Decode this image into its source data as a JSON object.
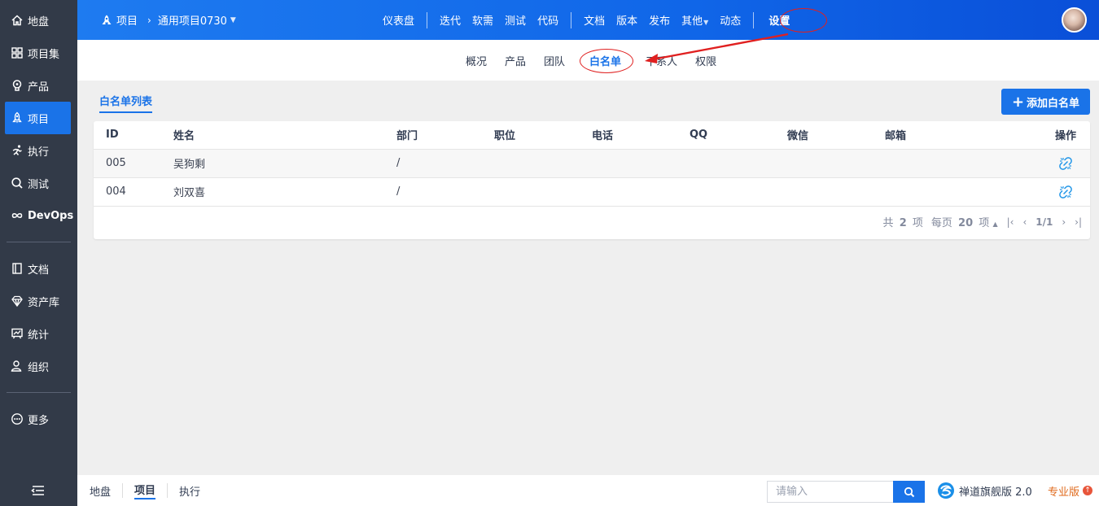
{
  "sidebar": {
    "items": [
      {
        "label": "地盘",
        "icon": "home-icon"
      },
      {
        "label": "项目集",
        "icon": "grid-icon"
      },
      {
        "label": "产品",
        "icon": "bulb-icon"
      },
      {
        "label": "项目",
        "icon": "rocket-icon",
        "active": true
      },
      {
        "label": "执行",
        "icon": "run-icon"
      },
      {
        "label": "测试",
        "icon": "magnifier-icon"
      },
      {
        "label": "DevOps",
        "icon": "infinity-icon"
      },
      {
        "label": "文档",
        "icon": "book-icon"
      },
      {
        "label": "资产库",
        "icon": "diamond-icon"
      },
      {
        "label": "统计",
        "icon": "chart-board-icon"
      },
      {
        "label": "组织",
        "icon": "people-icon"
      },
      {
        "label": "更多",
        "icon": "more-circle-icon"
      }
    ]
  },
  "header": {
    "module": "项目",
    "project": "通用项目0730",
    "nav": [
      "仪表盘",
      "迭代",
      "软需",
      "测试",
      "代码",
      "文档",
      "版本",
      "发布",
      "其他",
      "动态",
      "设置"
    ]
  },
  "subnav": {
    "items": [
      "概况",
      "产品",
      "团队",
      "白名单",
      "干系人",
      "权限"
    ],
    "active": "白名单"
  },
  "main": {
    "list_tab": "白名单列表",
    "add_button": "添加白名单",
    "columns": [
      "ID",
      "姓名",
      "部门",
      "职位",
      "电话",
      "QQ",
      "微信",
      "邮箱",
      "操作"
    ],
    "rows": [
      {
        "id": "005",
        "name": "吴狗剩",
        "dept": "/",
        "position": "",
        "phone": "",
        "qq": "",
        "wechat": "",
        "email": ""
      },
      {
        "id": "004",
        "name": "刘双喜",
        "dept": "/",
        "position": "",
        "phone": "",
        "qq": "",
        "wechat": "",
        "email": ""
      }
    ],
    "pager": {
      "total_prefix": "共",
      "total": "2",
      "total_suffix": "项",
      "per_page_prefix": "每页",
      "per_page": "20",
      "per_page_suffix": "项",
      "page": "1/1"
    }
  },
  "footer": {
    "crumbs": [
      "地盘",
      "项目",
      "执行"
    ],
    "active": "项目",
    "search_placeholder": "请输入",
    "brand": "禅道旗舰版 2.0",
    "pro": "专业版"
  },
  "colors": {
    "accent": "#1a73e8",
    "sidebar": "#323a48",
    "annotation": "#e02020",
    "pro": "#e06a1c"
  }
}
